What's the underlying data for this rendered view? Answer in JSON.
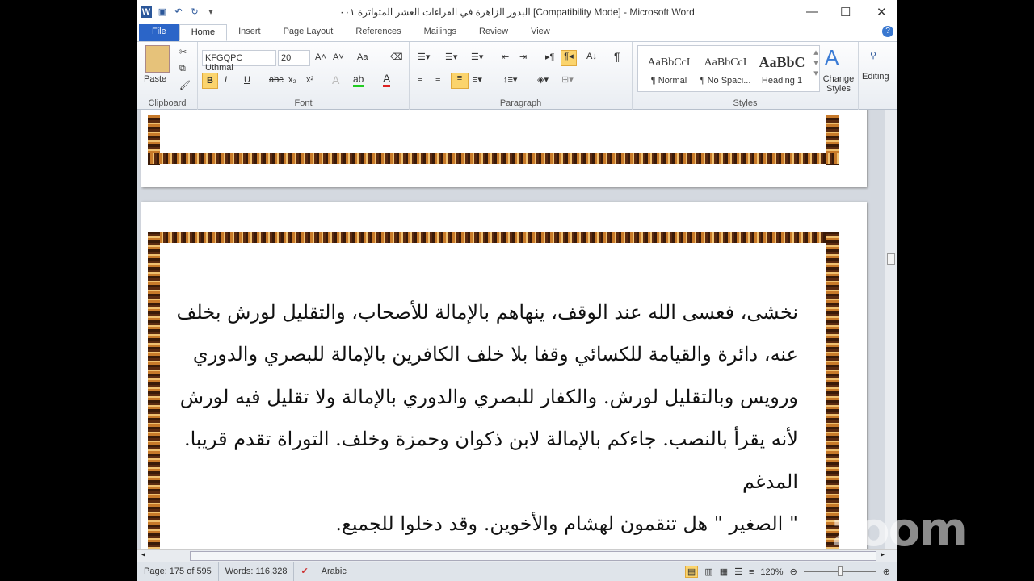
{
  "titlebar": {
    "title": "البدور الزاهرة في القراءات العشر المتواترة ٠٠١ [Compatibility Mode] - Microsoft Word",
    "minimize": "—",
    "maximize": "☐",
    "close": "✕"
  },
  "tabs": [
    "File",
    "Home",
    "Insert",
    "Page Layout",
    "References",
    "Mailings",
    "Review",
    "View"
  ],
  "ribbon": {
    "clipboard": {
      "label": "Clipboard",
      "paste": "Paste"
    },
    "font": {
      "label": "Font",
      "name": "KFGQPC Uthmai",
      "size": "20",
      "bold": "B",
      "italic": "I",
      "underline": "U",
      "strike": "abc",
      "sub": "x₂",
      "sup": "x²",
      "grow": "A˄",
      "shrink": "A˅",
      "case": "Aa"
    },
    "paragraph": {
      "label": "Paragraph",
      "pilcrow": "¶"
    },
    "styles": {
      "label": "Styles",
      "items": [
        {
          "sample": "AaBbCcI",
          "name": "¶ Normal"
        },
        {
          "sample": "AaBbCcI",
          "name": "¶ No Spaci..."
        },
        {
          "sample": "AaBbC",
          "name": "Heading 1"
        }
      ],
      "change": "Change Styles"
    },
    "editing": {
      "label": "Editing"
    }
  },
  "document": {
    "lines": [
      "نخشى، فعسى الله عند الوقف، ينهاهم بالإمالة للأصحاب، والتقليل لورش بخلف",
      "عنه، دائرة والقيامة للكسائي وقفا بلا خلف الكافرين بالإمالة للبصري والدوري",
      "ورويس وبالتقليل لورش. والكفار للبصري والدوري بالإمالة ولا تقليل فيه لورش",
      "لأنه يقرأ بالنصب. جاءكم بالإمالة لابن ذكوان وحمزة وخلف. التوراة تقدم قريبا.",
      "المدغم",
      "\" الصغير \" هل تنقمون لهشام والأخوين. وقد دخلوا للجميع."
    ]
  },
  "status": {
    "page": "Page: 175 of 595",
    "words": "Words: 116,328",
    "language": "Arabic",
    "zoom": "120%"
  },
  "watermark": "zoom"
}
